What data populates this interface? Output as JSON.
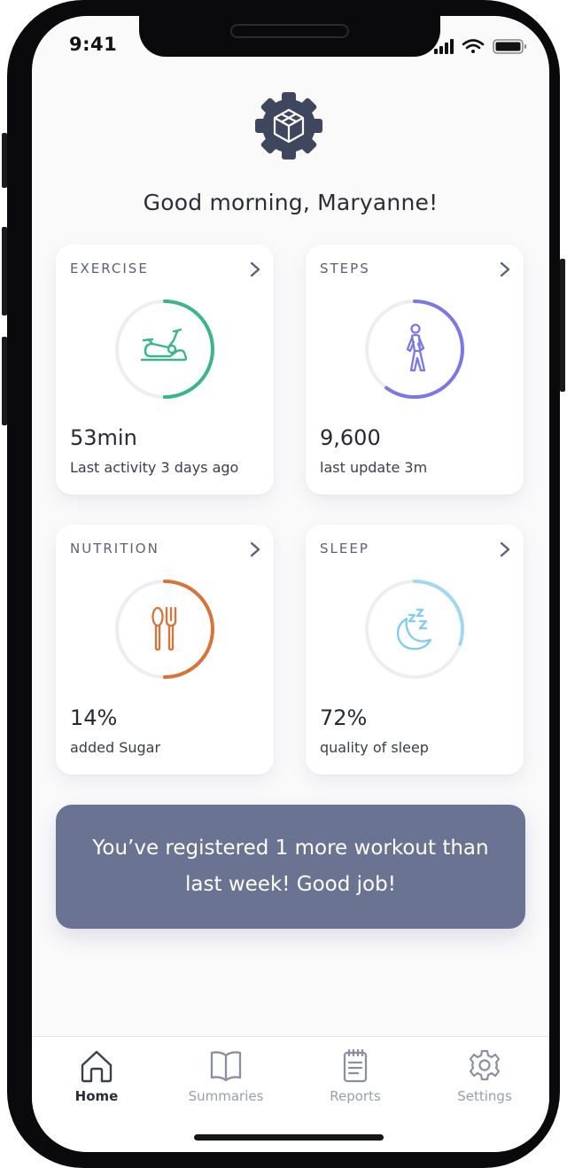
{
  "status_bar": {
    "time": "9:41",
    "icons": [
      "signal-icon",
      "wifi-icon",
      "battery-icon"
    ]
  },
  "header": {
    "logo_icon": "gear-cube-logo",
    "greeting": "Good morning, Maryanne!"
  },
  "cards": [
    {
      "title": "EXERCISE",
      "value": "53min",
      "subtitle": "Last activity 3 days ago",
      "icon": "exercise-bike-icon",
      "color": "#3bb68a",
      "progress": 0.5
    },
    {
      "title": "STEPS",
      "value": "9,600",
      "subtitle": "last update 3m",
      "icon": "walking-icon",
      "color": "#7b78e6",
      "progress": 0.6
    },
    {
      "title": "NUTRITION",
      "value": "14%",
      "subtitle": "added Sugar",
      "icon": "utensils-icon",
      "color": "#d8733a",
      "progress": 0.5
    },
    {
      "title": "SLEEP",
      "value": "72%",
      "subtitle": "quality of sleep",
      "icon": "moon-zzz-icon",
      "color": "#9fd8f0",
      "progress": 0.3
    }
  ],
  "banner": {
    "text": "You’ve registered 1 more workout than last week! Good job!"
  },
  "tabbar": {
    "tabs": [
      {
        "label": "Home",
        "icon": "home-icon",
        "active": true
      },
      {
        "label": "Summaries",
        "icon": "book-icon",
        "active": false
      },
      {
        "label": "Reports",
        "icon": "notepad-icon",
        "active": false
      },
      {
        "label": "Settings",
        "icon": "gear-icon",
        "active": false
      }
    ]
  },
  "colors": {
    "banner": "#6b7392",
    "text_dark": "#2b2e36",
    "card_title": "#5c6178",
    "ring_track": "#eceef2"
  }
}
